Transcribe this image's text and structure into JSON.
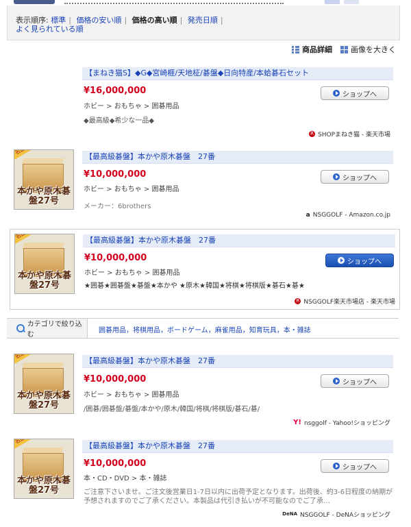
{
  "sort": {
    "label": "表示順序:",
    "options": [
      "標準",
      "価格の安い順",
      "価格の高い順",
      "発売日順",
      "よく見られている順"
    ],
    "current_index": 2
  },
  "view": {
    "details_label": "商品詳細",
    "large_label": "画像を大きく"
  },
  "shop_button_label": "ショップへ",
  "items": [
    {
      "title": "【まねき猫S】◆G◆宮崎榧/天地柾/碁盤◆日向特産/本蛤碁石セット",
      "price": "¥16,000,000",
      "category": "ホビー > おもちゃ > 囲碁用品",
      "desc": "◆最高級◆希少な一品◆",
      "shop": "SHOPまねき猫 - 楽天市場",
      "shop_icon": "rakuten-icon"
    },
    {
      "title": "【最高級碁盤】本かや原木碁盤　27番",
      "price": "¥10,000,000",
      "category": "ホビー > おもちゃ > 囲碁用品",
      "maker": "メーカー：6brothers",
      "shop": "NSGGOLF - Amazon.co.jp",
      "shop_icon": "amazon-icon",
      "thumb_badge": "名品",
      "thumb_caption": "本かや原木碁盤27号"
    },
    {
      "title": "【最高級碁盤】本かや原木碁盤　27番",
      "price": "¥10,000,000",
      "category": "ホビー > おもちゃ > 囲碁用品",
      "desc": "★囲碁★囲碁盤★碁盤★本かや ★原木★韓国★将棋★将棋版★碁石★碁★",
      "shop": "NSGGOLF楽天市場店 - 楽天市場",
      "shop_icon": "rakuten-icon",
      "thumb_badge": "名品",
      "thumb_caption": "本かや原木碁盤27号"
    },
    {
      "title": "【最高級碁盤】本かや原木碁盤　27番",
      "price": "¥10,000,000",
      "category": "ホビー > おもちゃ > 囲碁用品",
      "desc": "/囲碁/囲碁盤/碁盤/本かや/原木/韓国/将棋/将棋版/碁石/碁/",
      "shop": "nsggolf - Yahoo!ショッピング",
      "shop_icon": "yahoo-icon",
      "thumb_badge": "名品",
      "thumb_caption": "本かや原木碁盤27号"
    },
    {
      "title": "【最高級碁盤】本かや原木碁盤　27番",
      "price": "¥10,000,000",
      "category": "本・CD・DVD > 本・雑誌",
      "desc": "ご注意下さいませ。ご注文後営業日1-7日以内に出荷予定となります。出荷後、約3-6日程度の納期が予想されますのでご了承ください。本製品は代引き払いが不可能なのでご了承…",
      "shop": "NSGGOLF - DeNAショッピング",
      "shop_icon": "dena-icon",
      "thumb_badge": "名品",
      "thumb_caption": "本かや原木碁盤27号"
    }
  ],
  "refine": {
    "label": "カテゴリで絞り込む",
    "links": "囲碁用品，将棋用品，ボードゲーム，麻雀用品，知育玩具，本・雑誌"
  }
}
